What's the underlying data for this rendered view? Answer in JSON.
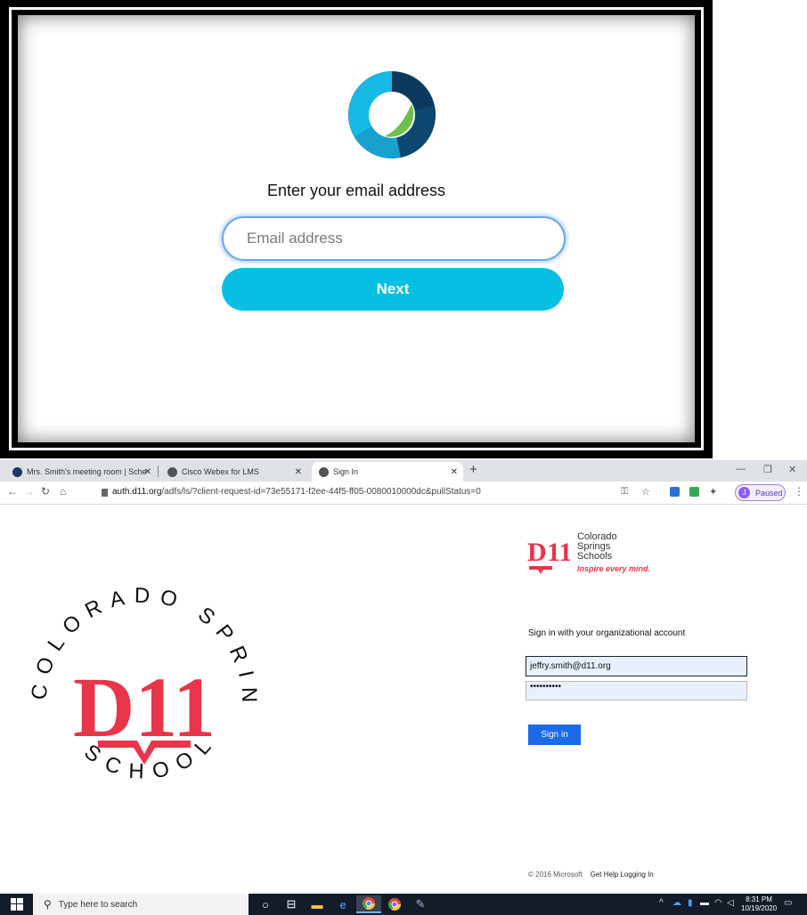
{
  "webex": {
    "prompt": "Enter your email address",
    "email_placeholder": "Email address",
    "next_label": "Next"
  },
  "browser": {
    "tabs": [
      {
        "title": "Mrs. Smith's meeting room | Sche",
        "icon": "webex-icon"
      },
      {
        "title": "Cisco Webex for LMS",
        "icon": "globe-icon"
      },
      {
        "title": "Sign In",
        "icon": "globe-icon",
        "active": true
      }
    ],
    "url_host": "auth.d11.org",
    "url_path": "/adfs/ls/?client-request-id=73e55171-f2ee-44f5-ff05-0080010000dc&pullStatus=0",
    "profile_initial": "J",
    "profile_status": "Paused"
  },
  "signin": {
    "brand_line1": "Colorado",
    "brand_line2": "Springs",
    "brand_line3": "Schools",
    "brand_tagline": "Inspire every mind.",
    "logo_text": "D11",
    "seal_top_text": "COLORADO SPRINGS",
    "seal_bottom_text": "SCHOOLS",
    "heading": "Sign in with your organizational account",
    "username_value": "jeffry.smith@d11.org",
    "password_mask": "••••••••••",
    "button_label": "Sign in",
    "copyright": "© 2016 Microsoft",
    "help_link": "Get Help Logging In"
  },
  "taskbar": {
    "search_placeholder": "Type here to search",
    "time": "8:31 PM",
    "date": "10/19/2020"
  },
  "colors": {
    "webex_accent": "#07bfe3",
    "d11_red": "#e8354a",
    "signin_blue": "#1b6ae8",
    "taskbar": "#141b29"
  }
}
